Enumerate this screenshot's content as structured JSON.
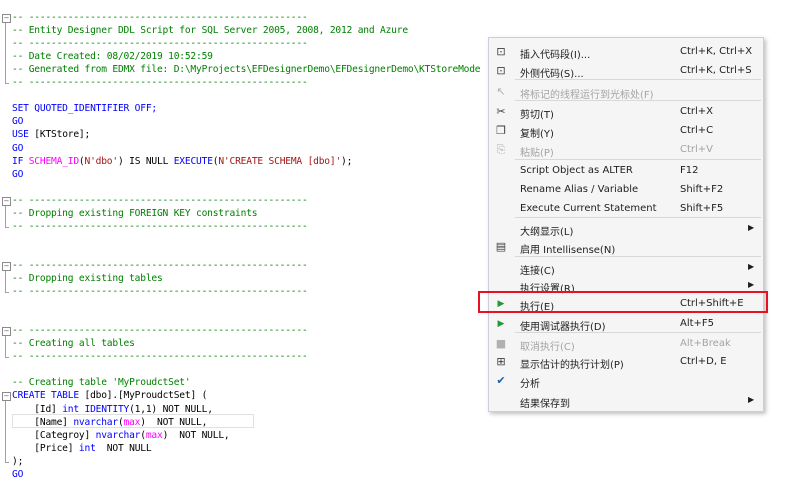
{
  "code": {
    "lines": [
      {
        "text": "-- --------------------------------------------------",
        "cls": "comment"
      },
      {
        "text": "-- Entity Designer DDL Script for SQL Server 2005, 2008, 2012 and Azure",
        "cls": "comment"
      },
      {
        "text": "-- --------------------------------------------------",
        "cls": "comment"
      },
      {
        "text": "-- Date Created: 08/02/2019 10:52:59",
        "cls": "comment"
      },
      {
        "text": "-- Generated from EDMX file: D:\\MyProjects\\EFDesignerDemo\\EFDesignerDemo\\KTStoreMode",
        "cls": "comment"
      },
      {
        "text": "-- --------------------------------------------------",
        "cls": "comment"
      },
      {
        "text": "",
        "cls": "plain"
      },
      {
        "text": "SET QUOTED_IDENTIFIER OFF;",
        "cls": "kw"
      },
      {
        "text": "GO",
        "cls": "kw"
      },
      {
        "text": "USE [KTStore];",
        "cls": "mix_use"
      },
      {
        "text": "GO",
        "cls": "kw"
      },
      {
        "text": "IF SCHEMA_ID(N'dbo') IS NULL EXECUTE(N'CREATE SCHEMA [dbo]');",
        "cls": "mix_if"
      },
      {
        "text": "GO",
        "cls": "kw"
      },
      {
        "text": "",
        "cls": "plain"
      },
      {
        "text": "-- --------------------------------------------------",
        "cls": "comment"
      },
      {
        "text": "-- Dropping existing FOREIGN KEY constraints",
        "cls": "comment"
      },
      {
        "text": "-- --------------------------------------------------",
        "cls": "comment"
      },
      {
        "text": "",
        "cls": "plain"
      },
      {
        "text": "",
        "cls": "plain"
      },
      {
        "text": "-- --------------------------------------------------",
        "cls": "comment"
      },
      {
        "text": "-- Dropping existing tables",
        "cls": "comment"
      },
      {
        "text": "-- --------------------------------------------------",
        "cls": "comment"
      },
      {
        "text": "",
        "cls": "plain"
      },
      {
        "text": "",
        "cls": "plain"
      },
      {
        "text": "-- --------------------------------------------------",
        "cls": "comment"
      },
      {
        "text": "-- Creating all tables",
        "cls": "comment"
      },
      {
        "text": "-- --------------------------------------------------",
        "cls": "comment"
      },
      {
        "text": "",
        "cls": "plain"
      },
      {
        "text": "-- Creating table 'MyProudctSet'",
        "cls": "comment"
      },
      {
        "text": "CREATE TABLE [dbo].[MyProudctSet] (",
        "cls": "mix_create"
      },
      {
        "text": "    [Id] int IDENTITY(1,1) NOT NULL,",
        "cls": "mix_id"
      },
      {
        "text": "    [Name] nvarchar(max)  NOT NULL,",
        "cls": "mix_name"
      },
      {
        "text": "    [Categroy] nvarchar(max)  NOT NULL,",
        "cls": "mix_cat"
      },
      {
        "text": "    [Price] int  NOT NULL",
        "cls": "mix_price"
      },
      {
        "text": ");",
        "cls": "plain"
      },
      {
        "text": "GO",
        "cls": "kw"
      }
    ]
  },
  "menu": {
    "items": [
      {
        "icon": "snippet-insert-icon",
        "glyph": "⊡",
        "label": "插入代码段(I)...",
        "shortcut": "Ctrl+K, Ctrl+X",
        "disabled": false,
        "submenu": false
      },
      {
        "icon": "surround-with-icon",
        "glyph": "⊡",
        "label": "外侧代码(S)...",
        "shortcut": "Ctrl+K, Ctrl+S",
        "disabled": false,
        "submenu": false
      },
      {
        "icon": "run-to-cursor-icon",
        "glyph": "↖",
        "label": "将标记的线程运行到光标处(F)",
        "shortcut": "",
        "disabled": true,
        "submenu": false
      },
      {
        "icon": "cut-icon",
        "glyph": "✂",
        "label": "剪切(T)",
        "shortcut": "Ctrl+X",
        "disabled": false,
        "submenu": false
      },
      {
        "icon": "copy-icon",
        "glyph": "❐",
        "label": "复制(Y)",
        "shortcut": "Ctrl+C",
        "disabled": false,
        "submenu": false
      },
      {
        "icon": "paste-icon",
        "glyph": "⎘",
        "label": "粘贴(P)",
        "shortcut": "Ctrl+V",
        "disabled": true,
        "submenu": false
      },
      {
        "icon": "",
        "glyph": "",
        "label": "Script Object as ALTER",
        "shortcut": "F12",
        "disabled": false,
        "submenu": false
      },
      {
        "icon": "",
        "glyph": "",
        "label": "Rename Alias / Variable",
        "shortcut": "Shift+F2",
        "disabled": false,
        "submenu": false
      },
      {
        "icon": "",
        "glyph": "",
        "label": "Execute Current Statement",
        "shortcut": "Shift+F5",
        "disabled": false,
        "submenu": false
      },
      {
        "icon": "",
        "glyph": "",
        "label": "大纲显示(L)",
        "shortcut": "",
        "disabled": false,
        "submenu": true
      },
      {
        "icon": "intellisense-icon",
        "glyph": "▤",
        "label": "启用 Intellisense(N)",
        "shortcut": "",
        "disabled": false,
        "submenu": false
      },
      {
        "icon": "",
        "glyph": "",
        "label": "连接(C)",
        "shortcut": "",
        "disabled": false,
        "submenu": true
      },
      {
        "icon": "",
        "glyph": "",
        "label": "执行设置(R)",
        "shortcut": "",
        "disabled": false,
        "submenu": true
      },
      {
        "icon": "execute-icon",
        "glyph": "▶",
        "label": "执行(E)",
        "shortcut": "Ctrl+Shift+E",
        "disabled": false,
        "submenu": false
      },
      {
        "icon": "debug-execute-icon",
        "glyph": "▶",
        "label": "使用调试器执行(D)",
        "shortcut": "Alt+F5",
        "disabled": false,
        "submenu": false
      },
      {
        "icon": "cancel-execute-icon",
        "glyph": "■",
        "label": "取消执行(C)",
        "shortcut": "Alt+Break",
        "disabled": true,
        "submenu": false
      },
      {
        "icon": "execution-plan-icon",
        "glyph": "⊞",
        "label": "显示估计的执行计划(P)",
        "shortcut": "Ctrl+D, E",
        "disabled": false,
        "submenu": false
      },
      {
        "icon": "parse-check-icon",
        "glyph": "✔",
        "label": "分析",
        "shortcut": "",
        "disabled": false,
        "submenu": false
      },
      {
        "icon": "",
        "glyph": "",
        "label": "结果保存到",
        "shortcut": "",
        "disabled": false,
        "submenu": true
      }
    ],
    "colors": {
      "execute": "#1e9b32",
      "highlight_border": "#e81123",
      "check": "#1a5fb4"
    }
  }
}
